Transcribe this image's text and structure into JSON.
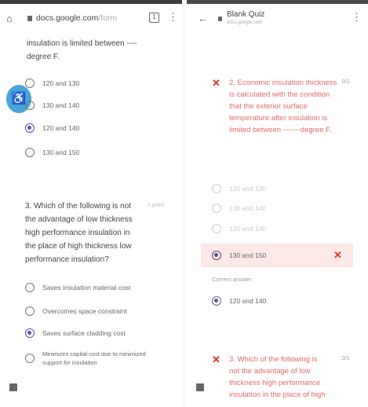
{
  "left": {
    "url_domain": "docs.google.com",
    "url_path": "/form",
    "tabs_count": "1",
    "q2_tail": "insulation is limited between ----degree F.",
    "q2_options": [
      {
        "label": "120 and 130",
        "selected": false
      },
      {
        "label": "130 and 140",
        "selected": false
      },
      {
        "label": "120 and 140",
        "selected": true
      },
      {
        "label": "130 and 150",
        "selected": false
      }
    ],
    "q3_text": "3. Which of the following is not the advantage of low thickness high performance insulation in the place of high thickness low performance insulation?",
    "q3_points": "1 point",
    "q3_options": [
      {
        "label": "Saves insulation material cost",
        "selected": false
      },
      {
        "label": "Overcomes space constraint",
        "selected": false
      },
      {
        "label": "Saves surface cladding cost",
        "selected": true
      },
      {
        "label": "Minimizes capital cost due to minimized support for insulation",
        "selected": false
      }
    ]
  },
  "right": {
    "title": "Blank Quiz",
    "subtitle": "docs.google.com",
    "q2_text": "2. Economic insulation thickness is calculated with the condition that the exterior surface temperature after insulation is limited between -------degree F.",
    "q2_score": "0/1",
    "q2_options": [
      {
        "label": "120 and 130"
      },
      {
        "label": "130 and 140"
      },
      {
        "label": "120 and 140"
      },
      {
        "label": "130 and 150"
      }
    ],
    "correct_label": "Correct answer",
    "correct_answer": "120 and 140",
    "q3_text": "3. Which of the following is not the advantage of low thickness high performance insulation in the place of high",
    "q3_score": "0/1"
  }
}
